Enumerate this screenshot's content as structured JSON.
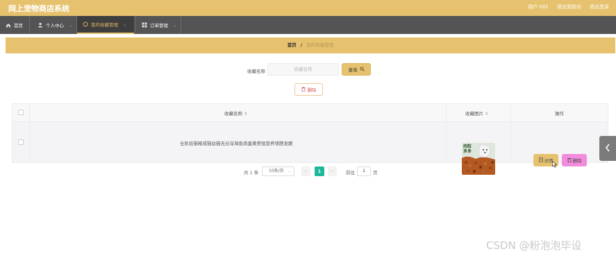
{
  "app": {
    "title": "网上宠物商店系统"
  },
  "top_links": {
    "user": "用户 001",
    "backend": "退出到前台",
    "logout": "退出登录"
  },
  "nav": {
    "items": [
      {
        "label": "首页",
        "icon": "home-icon"
      },
      {
        "label": "个人中心",
        "icon": "user-icon"
      },
      {
        "label": "我的收藏管理",
        "icon": "circle-icon",
        "active": true
      },
      {
        "label": "订单管理",
        "icon": "grid-icon"
      }
    ]
  },
  "breadcrumb": {
    "home": "首页",
    "separator": "/",
    "current": "我的收藏管理"
  },
  "search": {
    "label": "收藏名称",
    "placeholder": "收藏名称",
    "button": "查询"
  },
  "actions": {
    "delete": "删除"
  },
  "table": {
    "columns": [
      "收藏名称",
      "收藏图片",
      "操作"
    ],
    "rows": [
      {
        "name": "全阶段猫粮成猫幼猫无谷深海鱼肉蛋黄美短营养增肥发腮",
        "image_label": "肉粒多多",
        "detail": "详情",
        "delete": "删除"
      }
    ]
  },
  "pagination": {
    "total": "共 1 条",
    "page_size": "10条/页",
    "current_page": "1",
    "goto_label": "前往",
    "goto_value": "1",
    "page_unit": "页"
  },
  "watermark": "CSDN @粉泡泡毕设",
  "colors": {
    "header": "#e6c26f",
    "nav": "#545454",
    "accent_green": "#20b89a",
    "delete_pink": "#f38bdc"
  }
}
